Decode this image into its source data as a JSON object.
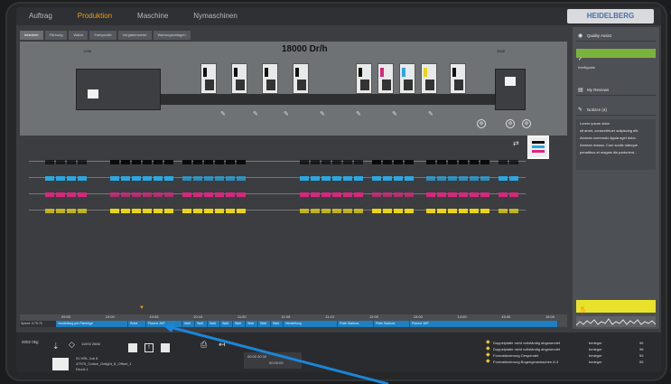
{
  "nav": {
    "tabs": [
      {
        "label": "Auftrag",
        "active": false
      },
      {
        "label": "Produktion",
        "active": true
      },
      {
        "label": "Maschine",
        "active": false
      },
      {
        "label": "Nymaschinen",
        "active": false
      }
    ],
    "brand": "HEIDELBERG"
  },
  "subtabs": [
    "Inbetrieb",
    "Färbung",
    "Walze",
    "Farbprofile",
    "Vorgabenwerte",
    "Wartungsanlagen"
  ],
  "press": {
    "speed": "18000 Dr/h",
    "left_label": "1268",
    "right_label": "3508"
  },
  "sidebar": {
    "quality_label": "Quality Assist",
    "intelliguide": "Intelliguide",
    "my_reviews": "My Reviews",
    "notizen": "Notizen (4)",
    "notes": [
      "Lorem ipsum dolor",
      "sit amet, consectetuer adipiscing elit.",
      "Aenean commodo ligula eget dolor.",
      "Aenean massa. Cum sociis natoque",
      "penatibus et magnis dis parturient..."
    ]
  },
  "timeline": {
    "left_label": "Speed: 0:75:75",
    "times": [
      "09:55",
      "10:00",
      "10:05",
      "10:10",
      "11:00",
      "11:05",
      "11:10",
      "12:00",
      "13:00",
      "14:00",
      "15:00",
      "16:00"
    ],
    "segments": [
      "Vorstellung per Planfolge",
      "Ruhe",
      "Planed JWT",
      "Wait",
      "Wait",
      "Wait",
      "Wait",
      "Wait",
      "Wait",
      "Wait",
      "Wait",
      "Herstellung",
      "Plate Stallons",
      "Plate Stallons",
      "Planed JWT"
    ]
  },
  "bottom": {
    "speed_label": "0002\n0kg",
    "counter": "11000\n2666",
    "job_id": "91 HRL Job 8",
    "job_name": "47975_Cotton_Delight_8_Offset_1",
    "job_sub": "Druck 1",
    "time1": "00:00 00 00",
    "time2": "00:00:00",
    "messages": [
      {
        "text": "Doppelplatte nicht vollständig abgesendet",
        "who": "bedeger",
        "n": "96"
      },
      {
        "text": "Doppelplatte nicht vollständig abgesendet",
        "who": "bedeger",
        "n": "96"
      },
      {
        "text": "Formatänderung Gespendet",
        "who": "bedeger",
        "n": "55"
      },
      {
        "text": "Formatänderung Bogengeradsschen 8-3",
        "who": "bedeger",
        "n": "55"
      }
    ]
  },
  "colors": {
    "accent": "#f39c12",
    "green": "#7ab33c",
    "yellow": "#e8e22a",
    "timeline_blue": "#1e7fc2",
    "cyan": "#2aa7df",
    "magenta": "#d9267d",
    "ink_yellow": "#e9d513",
    "black": "#0b0b0b"
  }
}
